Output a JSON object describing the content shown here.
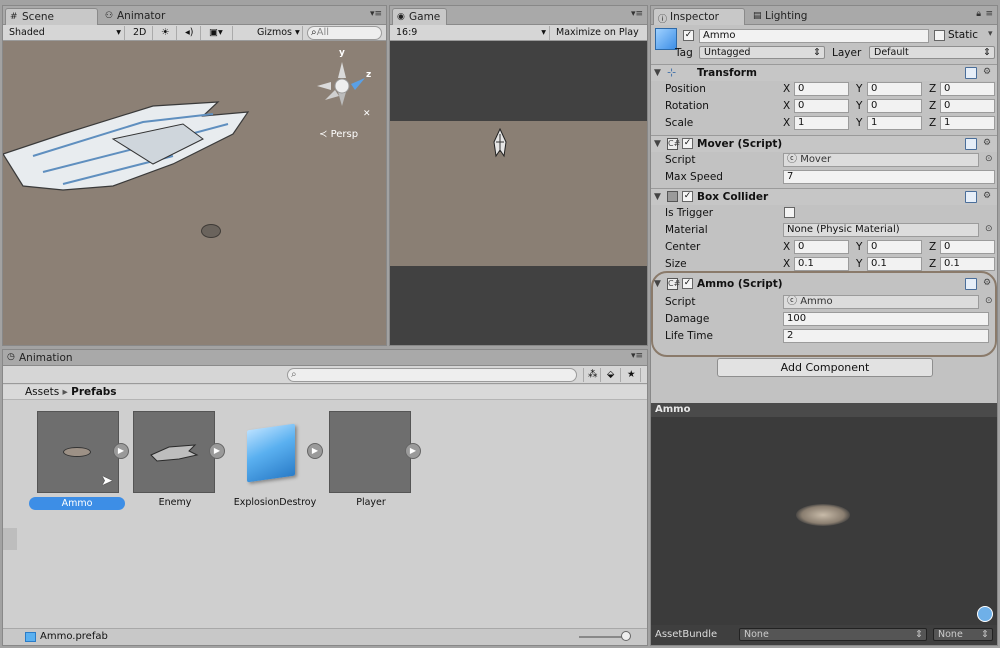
{
  "scene": {
    "tabs": [
      "Scene",
      "Animator"
    ],
    "shading": "Shaded",
    "mode_2d": "2D",
    "gizmos": "Gizmos",
    "search_placeholder": "All",
    "persp_label": "Persp",
    "axis_y": "y",
    "axis_z": "z"
  },
  "game": {
    "tab": "Game",
    "aspect": "16:9",
    "maximize_label": "Maximize on Play"
  },
  "inspector": {
    "tabs": [
      "Inspector",
      "Lighting"
    ],
    "object_name": "Ammo",
    "static_label": "Static",
    "tag_label": "Tag",
    "tag_value": "Untagged",
    "layer_label": "Layer",
    "layer_value": "Default",
    "transform": {
      "title": "Transform",
      "position_label": "Position",
      "rotation_label": "Rotation",
      "scale_label": "Scale",
      "position": [
        "0",
        "0",
        "0"
      ],
      "rotation": [
        "0",
        "0",
        "0"
      ],
      "scale": [
        "1",
        "1",
        "1"
      ]
    },
    "axis_labels": [
      "X",
      "Y",
      "Z"
    ],
    "mover": {
      "title": "Mover (Script)",
      "script_label": "Script",
      "script_value": "Mover",
      "max_speed_label": "Max Speed",
      "max_speed_value": "7"
    },
    "box_collider": {
      "title": "Box Collider",
      "trigger_label": "Is Trigger",
      "material_label": "Material",
      "material_value": "None (Physic Material)",
      "center_label": "Center",
      "center": [
        "0",
        "0",
        "0"
      ],
      "size_label": "Size",
      "size": [
        "0.1",
        "0.1",
        "0.1"
      ]
    },
    "ammo": {
      "title": "Ammo (Script)",
      "script_label": "Script",
      "script_value": "Ammo",
      "damage_label": "Damage",
      "damage_value": "100",
      "lifetime_label": "Life Time",
      "lifetime_value": "2"
    },
    "add_component": "Add Component",
    "preview_title": "Ammo",
    "assetbundle_label": "AssetBundle",
    "assetbundle_value": "None",
    "assetbundle_variant": "None"
  },
  "project": {
    "tab": "Animation",
    "breadcrumb_root": "Assets",
    "breadcrumb_sep": "▸",
    "breadcrumb_current": "Prefabs",
    "assets": [
      {
        "name": "Ammo"
      },
      {
        "name": "Enemy"
      },
      {
        "name": "ExplosionDestroy"
      },
      {
        "name": "Player"
      }
    ],
    "selected_file": "Ammo.prefab"
  },
  "colors": {
    "accent_blue": "#3d8ee6",
    "highlight_ring": "#8a7a6a",
    "scene_ground": "#8c8075",
    "game_band": "#8a7f74"
  }
}
